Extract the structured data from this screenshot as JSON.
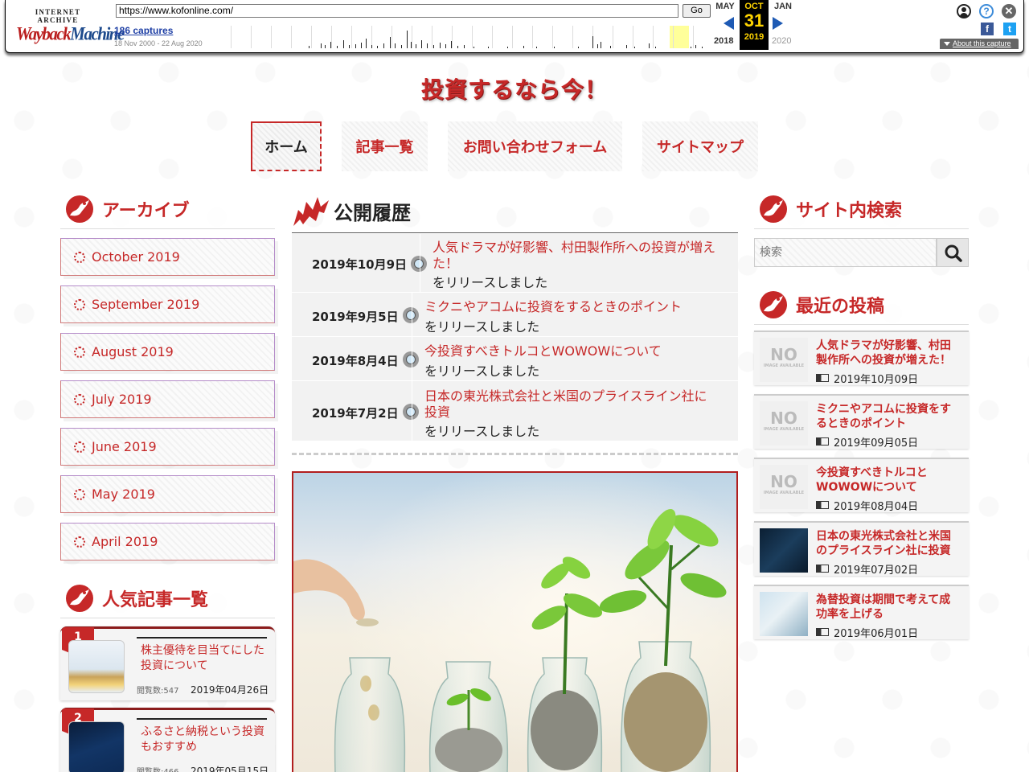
{
  "wayback": {
    "logo_top": "INTERNET ARCHIVE",
    "logo_wayback": "Wayback",
    "logo_machine": "Machine",
    "url": "https://www.kofonline.com/",
    "go_label": "Go",
    "captures": "186 captures",
    "range": "18 Nov 2000 - 22 Aug 2020",
    "prev_month": "MAY",
    "prev_year": "2018",
    "cur_month": "OCT",
    "cur_day": "31",
    "cur_year": "2019",
    "next_month": "JAN",
    "next_year": "2020",
    "about": "About this capture"
  },
  "site": {
    "title": "投資するなら今！",
    "nav": [
      "ホーム",
      "記事一覧",
      "お問い合わせフォーム",
      "サイトマップ"
    ]
  },
  "archive": {
    "heading": "アーカイブ",
    "items": [
      "October 2019",
      "September 2019",
      "August 2019",
      "July 2019",
      "June 2019",
      "May 2019",
      "April 2019"
    ]
  },
  "popular": {
    "heading": "人気記事一覧",
    "items": [
      {
        "rank": "1",
        "title": "株主優待を目当てにした投資について",
        "views": "閲覧数:547",
        "date": "2019年04月26日"
      },
      {
        "rank": "2",
        "title": "ふるさと納税という投資もおすすめ",
        "views": "閲覧数:466",
        "date": "2019年05月15日"
      }
    ]
  },
  "publish": {
    "heading": "公開履歴",
    "released": "をリリースしました",
    "items": [
      {
        "date": "2019年10月9日",
        "title": "人気ドラマが好影響、村田製作所への投資が増えた！"
      },
      {
        "date": "2019年9月5日",
        "title": "ミクニやアコムに投資をするときのポイント"
      },
      {
        "date": "2019年8月4日",
        "title": "今投資すべきトルコとWOWOWについて"
      },
      {
        "date": "2019年7月2日",
        "title": "日本の東光株式会社と米国のプライスライン社に投資"
      }
    ]
  },
  "search": {
    "heading": "サイト内検索",
    "placeholder": "検索"
  },
  "recent": {
    "heading": "最近の投稿",
    "items": [
      {
        "title": "人気ドラマが好影響、村田製作所への投資が増えた！",
        "date": "2019年10月09日",
        "image": "no-image"
      },
      {
        "title": "ミクニやアコムに投資をするときのポイント",
        "date": "2019年09月05日",
        "image": "no-image"
      },
      {
        "title": "今投資すべきトルコとWOWOWについて",
        "date": "2019年08月04日",
        "image": "no-image"
      },
      {
        "title": "日本の東光株式会社と米国のプライスライン社に投資",
        "date": "2019年07月02日",
        "image": "photo-business"
      },
      {
        "title": "為替投資は期間で考えて成功率を上げる",
        "date": "2019年06月01日",
        "image": "photo-laptop"
      }
    ],
    "no_image_big": "NO",
    "no_image_small": "IMAGE AVAILABLE"
  },
  "colors": {
    "accent": "#c62828",
    "link_blue": "#1e3fa5",
    "wayback_yellow": "#ffd400"
  }
}
